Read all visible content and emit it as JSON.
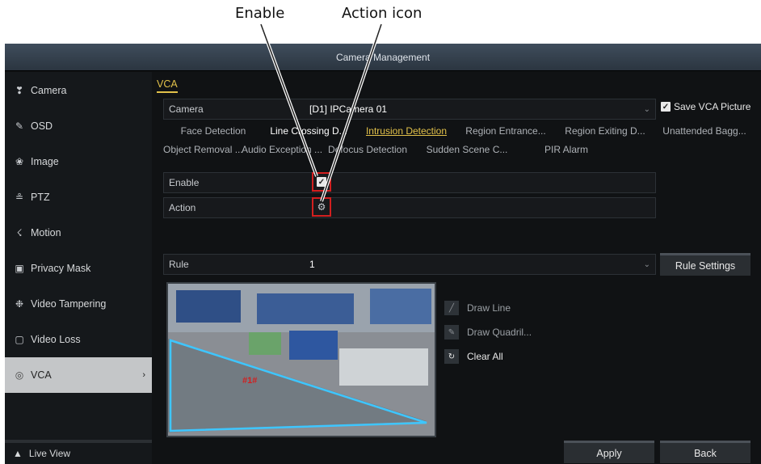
{
  "callouts": {
    "enable": "Enable",
    "action": "Action icon"
  },
  "window": {
    "title": "Camera Management"
  },
  "sidebar": {
    "items": [
      {
        "label": "Camera",
        "icon": "camera-icon",
        "glyph": "❣"
      },
      {
        "label": "OSD",
        "icon": "osd-icon",
        "glyph": "✎"
      },
      {
        "label": "Image",
        "icon": "image-icon",
        "glyph": "❀"
      },
      {
        "label": "PTZ",
        "icon": "ptz-icon",
        "glyph": "≗"
      },
      {
        "label": "Motion",
        "icon": "motion-icon",
        "glyph": "☇"
      },
      {
        "label": "Privacy Mask",
        "icon": "privacy-mask-icon",
        "glyph": "▣"
      },
      {
        "label": "Video Tampering",
        "icon": "video-tampering-icon",
        "glyph": "❉"
      },
      {
        "label": "Video Loss",
        "icon": "video-loss-icon",
        "glyph": "▢"
      },
      {
        "label": "VCA",
        "icon": "vca-icon",
        "glyph": "◎",
        "active": true,
        "arrow": "›"
      }
    ],
    "live_view": "Live View"
  },
  "vca": {
    "tab": "VCA",
    "camera_label": "Camera",
    "camera_value": "[D1] IPCamera 01",
    "save_vca_picture": "Save VCA Picture",
    "detection_tabs_row1": [
      "Face Detection",
      "Line Crossing D...",
      "Intrusion Detection",
      "Region Entrance...",
      "Region Exiting D...",
      "Unattended Bagg..."
    ],
    "detection_tabs_row2": [
      "Object Removal ...",
      "Audio Exception ...",
      "Defocus Detection",
      "Sudden Scene C...",
      "PIR Alarm"
    ],
    "selected_tab": "Intrusion Detection",
    "enable_label": "Enable",
    "enable_checked": true,
    "action_label": "Action",
    "rule_label": "Rule",
    "rule_value": "1",
    "rule_settings_button": "Rule Settings",
    "tools": {
      "draw_line": "Draw Line",
      "draw_quadrilateral": "Draw Quadril...",
      "clear_all": "Clear All"
    },
    "region_label": "#1#",
    "apply_button": "Apply",
    "back_button": "Back"
  },
  "colors": {
    "accent": "#e2c14a",
    "highlight": "#d21f1f",
    "region": "#3ec6ff"
  }
}
